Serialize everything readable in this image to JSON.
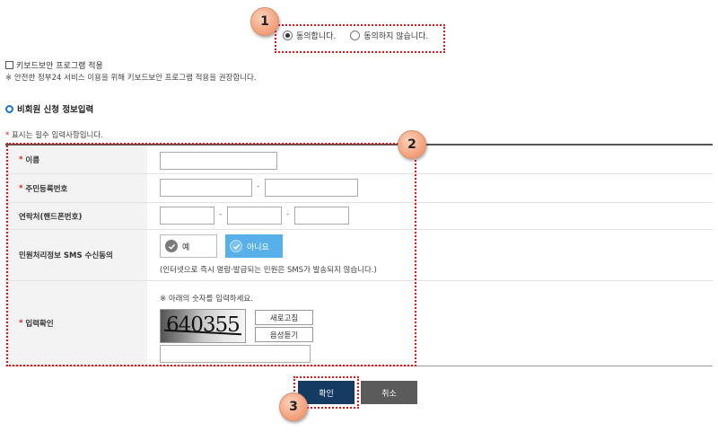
{
  "steps": {
    "one": "1",
    "two": "2",
    "three": "3"
  },
  "agreement": {
    "agree_label": "동의합니다.",
    "disagree_label": "동의하지 않습니다.",
    "selected": "agree"
  },
  "keyboard_security": {
    "checkbox_label": "키보드보안 프로그램 적용",
    "note": "※ 안전한 정부24 서비스 이용을 위해 키보드보안 프로그램 적용을 권장합니다."
  },
  "section": {
    "title": "비회원 신청 정보입력",
    "required_star": "*",
    "required_note": "표시는 필수 입력사항입니다."
  },
  "form": {
    "name_label": "이름",
    "rrn_label": "주민등록번호",
    "phone_label": "연락처(핸드폰번호)",
    "sms_label": "민원처리정보 SMS 수신동의",
    "captcha_label": "입력확인",
    "dash": "-",
    "name_value": "",
    "rrn_front": "",
    "rrn_back": "",
    "phone_1": "",
    "phone_2": "",
    "phone_3": "",
    "captcha_value": ""
  },
  "sms": {
    "yes_label": "예",
    "no_label": "아니요",
    "selected": "no",
    "note": "(인터넷으로 즉시 열람·발급되는 민원은 SMS가 발송되지 않습니다.)"
  },
  "captcha": {
    "instruction": "※ 아래의 숫자를 입력하세요.",
    "code": "640355",
    "refresh_label": "새로고침",
    "audio_label": "음성듣기"
  },
  "actions": {
    "confirm_label": "확인",
    "cancel_label": "취소"
  },
  "colors": {
    "highlight": "#e0161b",
    "confirm_bg": "#163b63",
    "cancel_bg": "#5b5b5b",
    "sms_no_bg": "#58b0ea",
    "section_ring": "#1a76c9"
  }
}
